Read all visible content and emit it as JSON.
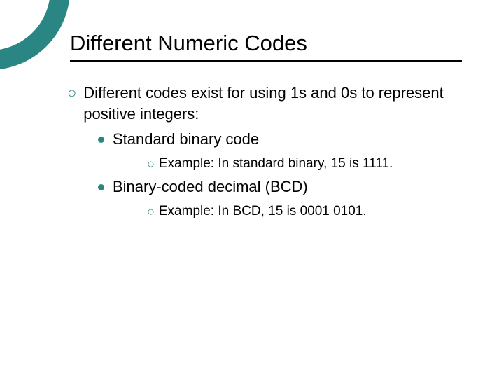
{
  "title": "Different Numeric Codes",
  "lvl1_text": "Different codes exist for using 1s and 0s to represent positive integers:",
  "items": [
    {
      "label": "Standard binary code",
      "example": "Example: In standard binary, 15 is 1111."
    },
    {
      "label": "Binary-coded decimal (BCD)",
      "example": "Example: In BCD, 15 is 0001 0101."
    }
  ]
}
